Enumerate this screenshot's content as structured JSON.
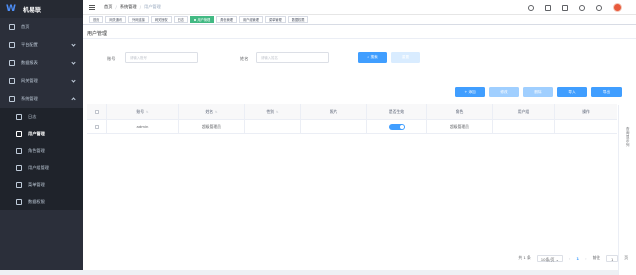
{
  "brand": {
    "name": "机易联"
  },
  "sidebar": {
    "items": [
      {
        "label": "首页",
        "icon": "home-icon"
      },
      {
        "label": "平台配置",
        "icon": "settings-icon",
        "expandable": true
      },
      {
        "label": "数据报表",
        "icon": "report-icon",
        "expandable": true
      },
      {
        "label": "网关管理",
        "icon": "gateway-icon",
        "expandable": true
      },
      {
        "label": "系统管理",
        "icon": "system-icon",
        "expandable": true,
        "expanded": true
      }
    ],
    "submenu": [
      {
        "label": "日志",
        "icon": "log-icon"
      },
      {
        "label": "用户管理",
        "icon": "user-icon",
        "active": true
      },
      {
        "label": "角色管理",
        "icon": "role-icon"
      },
      {
        "label": "用户组管理",
        "icon": "group-icon"
      },
      {
        "label": "菜单管理",
        "icon": "menu-icon"
      },
      {
        "label": "数据权限",
        "icon": "data-permission-icon"
      }
    ]
  },
  "breadcrumb": {
    "items": [
      "首页",
      "系统管理",
      "用户管理"
    ],
    "separator": "/"
  },
  "tags": [
    "首页",
    "网关通讯",
    "外网连接",
    "网关授权",
    "日志",
    "用户管理",
    "角色管理",
    "用户组管理",
    "菜单管理",
    "数据权限"
  ],
  "active_tag_index": 5,
  "page": {
    "title": "用户管理"
  },
  "search": {
    "account_label": "账号",
    "account_placeholder": "请输入账号",
    "name_label": "姓名",
    "name_placeholder": "请输入姓名",
    "search_button": "搜索",
    "reset_button": "重置"
  },
  "toolbar": {
    "add": "+ 添加",
    "edit": "修改",
    "delete": "删除",
    "import": "导入",
    "export": "导出"
  },
  "side_tab": {
    "label": "查询显示列"
  },
  "table": {
    "columns": [
      "",
      "账号",
      "姓名",
      "性别",
      "照片",
      "是否生效",
      "角色",
      "用户组",
      "操作"
    ],
    "rows": [
      {
        "account": "admin",
        "name": "超级管理员",
        "gender": "",
        "photo": "",
        "enabled": true,
        "role": "超级管理员",
        "group": "",
        "actions": ""
      }
    ]
  },
  "pagination": {
    "total": "共 1 条",
    "page_size": "10条/页",
    "current_page": "1",
    "goto_label": "前往",
    "goto_value": "1",
    "page_suffix": "页"
  },
  "colors": {
    "sidebar": "#2b2f3a",
    "primary": "#409eff",
    "active_tag": "#42b983"
  }
}
